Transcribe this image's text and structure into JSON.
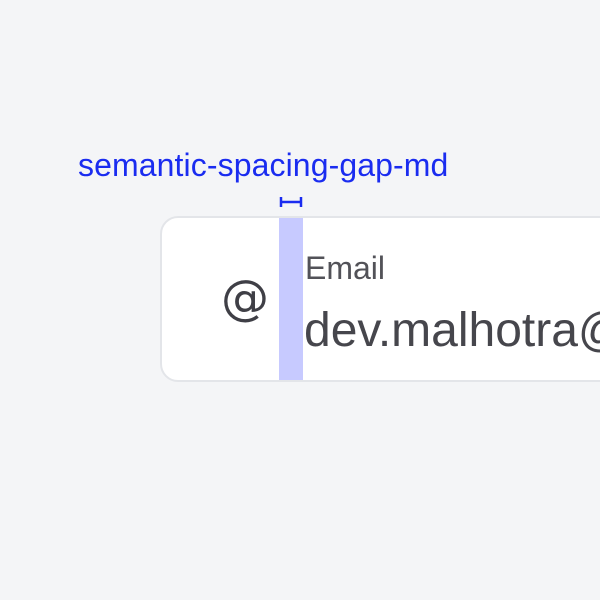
{
  "annotation": {
    "token_label": "semantic-spacing-gap-md",
    "accent_color": "#1a2cf0",
    "highlight_color": "#c7caff"
  },
  "field": {
    "icon": "at-sign-icon",
    "icon_glyph": "@",
    "label": "Email",
    "value": "dev.malhotra@"
  }
}
